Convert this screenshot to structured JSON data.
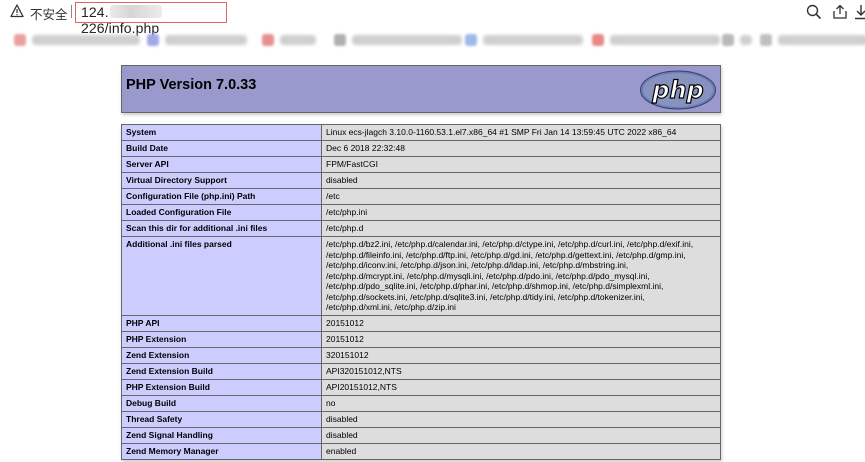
{
  "browser": {
    "insecure_label": "不安全",
    "url_prefix": "124.",
    "url_suffix": "226/info.php",
    "accent": "#e06464"
  },
  "bookmarks": [
    {
      "icon_color": "#e8a0a0"
    },
    {
      "icon_color": "#a0a8e8"
    },
    {
      "icon_color": "#e89090"
    },
    {
      "icon_color": "#b0b0b0"
    },
    {
      "icon_color": "#a0b8e8"
    },
    {
      "icon_color": "#e88888"
    },
    {
      "icon_color": "#b8b8b8"
    },
    {
      "icon_color": "#c0c0c0"
    }
  ],
  "php": {
    "version_title": "PHP Version 7.0.33",
    "logo_text": "php",
    "header_color": "#9999cc",
    "rows": [
      {
        "key": "System",
        "value": "Linux ecs-jlagch 3.10.0-1160.53.1.el7.x86_64 #1 SMP Fri Jan 14 13:59:45 UTC 2022 x86_64"
      },
      {
        "key": "Build Date",
        "value": "Dec 6 2018 22:32:48"
      },
      {
        "key": "Server API",
        "value": "FPM/FastCGI"
      },
      {
        "key": "Virtual Directory Support",
        "value": "disabled"
      },
      {
        "key": "Configuration File (php.ini) Path",
        "value": "/etc"
      },
      {
        "key": "Loaded Configuration File",
        "value": "/etc/php.ini"
      },
      {
        "key": "Scan this dir for additional .ini files",
        "value": "/etc/php.d"
      },
      {
        "key": "Additional .ini files parsed",
        "value": "/etc/php.d/bz2.ini, /etc/php.d/calendar.ini, /etc/php.d/ctype.ini, /etc/php.d/curl.ini, /etc/php.d/exif.ini,\n/etc/php.d/fileinfo.ini, /etc/php.d/ftp.ini, /etc/php.d/gd.ini, /etc/php.d/gettext.ini, /etc/php.d/gmp.ini,\n/etc/php.d/iconv.ini, /etc/php.d/json.ini, /etc/php.d/ldap.ini, /etc/php.d/mbstring.ini,\n/etc/php.d/mcrypt.ini, /etc/php.d/mysqli.ini, /etc/php.d/pdo.ini, /etc/php.d/pdo_mysql.ini,\n/etc/php.d/pdo_sqlite.ini, /etc/php.d/phar.ini, /etc/php.d/shmop.ini, /etc/php.d/simplexml.ini,\n/etc/php.d/sockets.ini, /etc/php.d/sqlite3.ini, /etc/php.d/tidy.ini, /etc/php.d/tokenizer.ini,\n/etc/php.d/xml.ini, /etc/php.d/zip.ini"
      },
      {
        "key": "PHP API",
        "value": "20151012"
      },
      {
        "key": "PHP Extension",
        "value": "20151012"
      },
      {
        "key": "Zend Extension",
        "value": "320151012"
      },
      {
        "key": "Zend Extension Build",
        "value": "API320151012,NTS"
      },
      {
        "key": "PHP Extension Build",
        "value": "API20151012,NTS"
      },
      {
        "key": "Debug Build",
        "value": "no"
      },
      {
        "key": "Thread Safety",
        "value": "disabled"
      },
      {
        "key": "Zend Signal Handling",
        "value": "disabled"
      },
      {
        "key": "Zend Memory Manager",
        "value": "enabled"
      }
    ]
  }
}
